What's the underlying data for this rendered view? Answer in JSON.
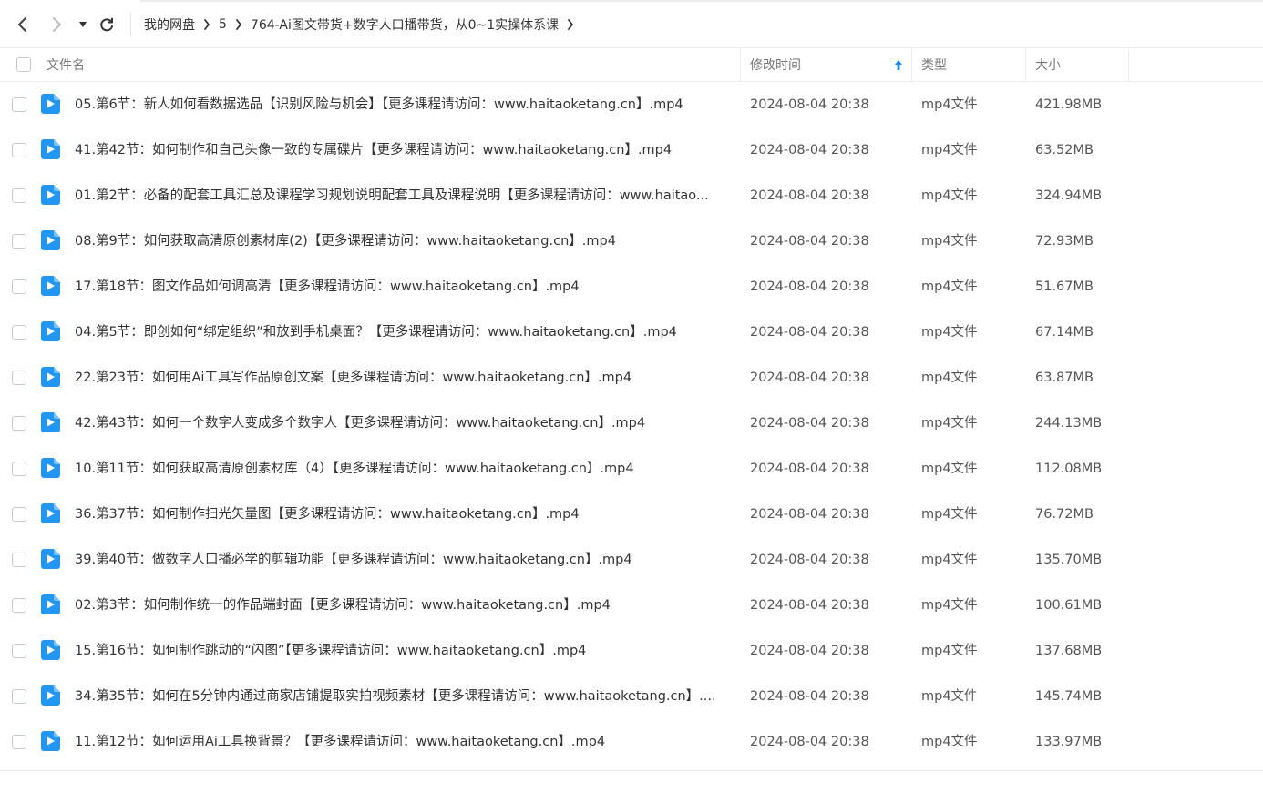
{
  "breadcrumb": [
    "我的网盘",
    "5",
    "764-Ai图文带货+数字人口播带货，从0~1实操体系课"
  ],
  "header": {
    "name": "文件名",
    "modified": "修改时间",
    "type": "类型",
    "size": "大小"
  },
  "colors": {
    "accent": "#1a8cff",
    "file_icon": "#2196f3"
  },
  "files": [
    {
      "name": "05.第6节：新人如何看数据选品【识别风险与机会】【更多课程请访问：www.haitaoketang.cn】.mp4",
      "time": "2024-08-04 20:38",
      "type": "mp4文件",
      "size": "421.98MB"
    },
    {
      "name": "41.第42节：如何制作和自己头像一致的专属碟片【更多课程请访问：www.haitaoketang.cn】.mp4",
      "time": "2024-08-04 20:38",
      "type": "mp4文件",
      "size": "63.52MB"
    },
    {
      "name": "01.第2节：必备的配套工具汇总及课程学习规划说明配套工具及课程说明【更多课程请访问：www.haitao...",
      "time": "2024-08-04 20:38",
      "type": "mp4文件",
      "size": "324.94MB"
    },
    {
      "name": "08.第9节：如何获取高清原创素材库(2)【更多课程请访问：www.haitaoketang.cn】.mp4",
      "time": "2024-08-04 20:38",
      "type": "mp4文件",
      "size": "72.93MB"
    },
    {
      "name": "17.第18节：图文作品如何调高清【更多课程请访问：www.haitaoketang.cn】.mp4",
      "time": "2024-08-04 20:38",
      "type": "mp4文件",
      "size": "51.67MB"
    },
    {
      "name": "04.第5节：即创如何“绑定组织”和放到手机桌面？【更多课程请访问：www.haitaoketang.cn】.mp4",
      "time": "2024-08-04 20:38",
      "type": "mp4文件",
      "size": "67.14MB"
    },
    {
      "name": "22.第23节：如何用Ai工具写作品原创文案【更多课程请访问：www.haitaoketang.cn】.mp4",
      "time": "2024-08-04 20:38",
      "type": "mp4文件",
      "size": "63.87MB"
    },
    {
      "name": "42.第43节：如何一个数字人变成多个数字人【更多课程请访问：www.haitaoketang.cn】.mp4",
      "time": "2024-08-04 20:38",
      "type": "mp4文件",
      "size": "244.13MB"
    },
    {
      "name": "10.第11节：如何获取高清原创素材库（4）【更多课程请访问：www.haitaoketang.cn】.mp4",
      "time": "2024-08-04 20:38",
      "type": "mp4文件",
      "size": "112.08MB"
    },
    {
      "name": "36.第37节：如何制作扫光矢量图【更多课程请访问：www.haitaoketang.cn】.mp4",
      "time": "2024-08-04 20:38",
      "type": "mp4文件",
      "size": "76.72MB"
    },
    {
      "name": "39.第40节：做数字人口播必学的剪辑功能【更多课程请访问：www.haitaoketang.cn】.mp4",
      "time": "2024-08-04 20:38",
      "type": "mp4文件",
      "size": "135.70MB"
    },
    {
      "name": "02.第3节：如何制作统一的作品端封面【更多课程请访问：www.haitaoketang.cn】.mp4",
      "time": "2024-08-04 20:38",
      "type": "mp4文件",
      "size": "100.61MB"
    },
    {
      "name": "15.第16节：如何制作跳动的“闪图”【更多课程请访问：www.haitaoketang.cn】.mp4",
      "time": "2024-08-04 20:38",
      "type": "mp4文件",
      "size": "137.68MB"
    },
    {
      "name": "34.第35节：如何在5分钟内通过商家店铺提取实拍视频素材【更多课程请访问：www.haitaoketang.cn】....",
      "time": "2024-08-04 20:38",
      "type": "mp4文件",
      "size": "145.74MB"
    },
    {
      "name": "11.第12节：如何运用Ai工具换背景？【更多课程请访问：www.haitaoketang.cn】.mp4",
      "time": "2024-08-04 20:38",
      "type": "mp4文件",
      "size": "133.97MB"
    }
  ]
}
